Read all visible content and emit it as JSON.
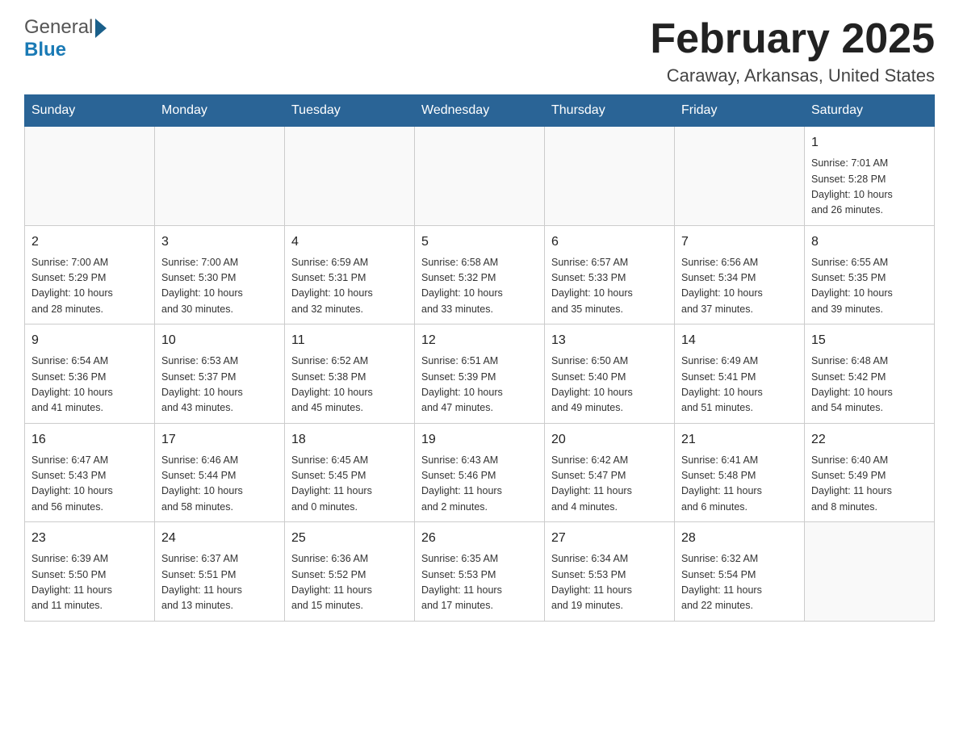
{
  "header": {
    "title": "February 2025",
    "location": "Caraway, Arkansas, United States",
    "logo_general": "General",
    "logo_blue": "Blue"
  },
  "weekdays": [
    "Sunday",
    "Monday",
    "Tuesday",
    "Wednesday",
    "Thursday",
    "Friday",
    "Saturday"
  ],
  "weeks": [
    [
      {
        "day": "",
        "info": ""
      },
      {
        "day": "",
        "info": ""
      },
      {
        "day": "",
        "info": ""
      },
      {
        "day": "",
        "info": ""
      },
      {
        "day": "",
        "info": ""
      },
      {
        "day": "",
        "info": ""
      },
      {
        "day": "1",
        "info": "Sunrise: 7:01 AM\nSunset: 5:28 PM\nDaylight: 10 hours\nand 26 minutes."
      }
    ],
    [
      {
        "day": "2",
        "info": "Sunrise: 7:00 AM\nSunset: 5:29 PM\nDaylight: 10 hours\nand 28 minutes."
      },
      {
        "day": "3",
        "info": "Sunrise: 7:00 AM\nSunset: 5:30 PM\nDaylight: 10 hours\nand 30 minutes."
      },
      {
        "day": "4",
        "info": "Sunrise: 6:59 AM\nSunset: 5:31 PM\nDaylight: 10 hours\nand 32 minutes."
      },
      {
        "day": "5",
        "info": "Sunrise: 6:58 AM\nSunset: 5:32 PM\nDaylight: 10 hours\nand 33 minutes."
      },
      {
        "day": "6",
        "info": "Sunrise: 6:57 AM\nSunset: 5:33 PM\nDaylight: 10 hours\nand 35 minutes."
      },
      {
        "day": "7",
        "info": "Sunrise: 6:56 AM\nSunset: 5:34 PM\nDaylight: 10 hours\nand 37 minutes."
      },
      {
        "day": "8",
        "info": "Sunrise: 6:55 AM\nSunset: 5:35 PM\nDaylight: 10 hours\nand 39 minutes."
      }
    ],
    [
      {
        "day": "9",
        "info": "Sunrise: 6:54 AM\nSunset: 5:36 PM\nDaylight: 10 hours\nand 41 minutes."
      },
      {
        "day": "10",
        "info": "Sunrise: 6:53 AM\nSunset: 5:37 PM\nDaylight: 10 hours\nand 43 minutes."
      },
      {
        "day": "11",
        "info": "Sunrise: 6:52 AM\nSunset: 5:38 PM\nDaylight: 10 hours\nand 45 minutes."
      },
      {
        "day": "12",
        "info": "Sunrise: 6:51 AM\nSunset: 5:39 PM\nDaylight: 10 hours\nand 47 minutes."
      },
      {
        "day": "13",
        "info": "Sunrise: 6:50 AM\nSunset: 5:40 PM\nDaylight: 10 hours\nand 49 minutes."
      },
      {
        "day": "14",
        "info": "Sunrise: 6:49 AM\nSunset: 5:41 PM\nDaylight: 10 hours\nand 51 minutes."
      },
      {
        "day": "15",
        "info": "Sunrise: 6:48 AM\nSunset: 5:42 PM\nDaylight: 10 hours\nand 54 minutes."
      }
    ],
    [
      {
        "day": "16",
        "info": "Sunrise: 6:47 AM\nSunset: 5:43 PM\nDaylight: 10 hours\nand 56 minutes."
      },
      {
        "day": "17",
        "info": "Sunrise: 6:46 AM\nSunset: 5:44 PM\nDaylight: 10 hours\nand 58 minutes."
      },
      {
        "day": "18",
        "info": "Sunrise: 6:45 AM\nSunset: 5:45 PM\nDaylight: 11 hours\nand 0 minutes."
      },
      {
        "day": "19",
        "info": "Sunrise: 6:43 AM\nSunset: 5:46 PM\nDaylight: 11 hours\nand 2 minutes."
      },
      {
        "day": "20",
        "info": "Sunrise: 6:42 AM\nSunset: 5:47 PM\nDaylight: 11 hours\nand 4 minutes."
      },
      {
        "day": "21",
        "info": "Sunrise: 6:41 AM\nSunset: 5:48 PM\nDaylight: 11 hours\nand 6 minutes."
      },
      {
        "day": "22",
        "info": "Sunrise: 6:40 AM\nSunset: 5:49 PM\nDaylight: 11 hours\nand 8 minutes."
      }
    ],
    [
      {
        "day": "23",
        "info": "Sunrise: 6:39 AM\nSunset: 5:50 PM\nDaylight: 11 hours\nand 11 minutes."
      },
      {
        "day": "24",
        "info": "Sunrise: 6:37 AM\nSunset: 5:51 PM\nDaylight: 11 hours\nand 13 minutes."
      },
      {
        "day": "25",
        "info": "Sunrise: 6:36 AM\nSunset: 5:52 PM\nDaylight: 11 hours\nand 15 minutes."
      },
      {
        "day": "26",
        "info": "Sunrise: 6:35 AM\nSunset: 5:53 PM\nDaylight: 11 hours\nand 17 minutes."
      },
      {
        "day": "27",
        "info": "Sunrise: 6:34 AM\nSunset: 5:53 PM\nDaylight: 11 hours\nand 19 minutes."
      },
      {
        "day": "28",
        "info": "Sunrise: 6:32 AM\nSunset: 5:54 PM\nDaylight: 11 hours\nand 22 minutes."
      },
      {
        "day": "",
        "info": ""
      }
    ]
  ]
}
